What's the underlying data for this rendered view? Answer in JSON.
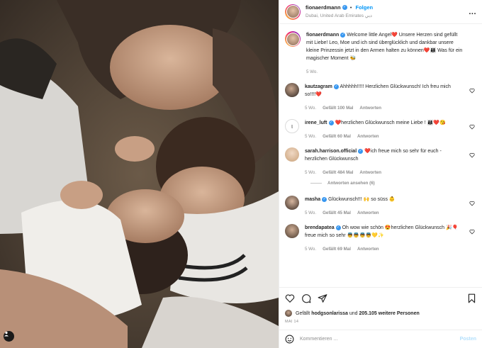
{
  "header": {
    "username": "fionaerdmann",
    "follow_label": "Folgen",
    "location": "Dubai, United Arab Emirates دبي",
    "separator": "•",
    "more_label": "..."
  },
  "caption": {
    "username": "fionaerdmann",
    "text": "Welcome little Angel❤️ Unsere Herzen sind gefüllt mit Liebe! Leo, Moe und ich sind überglücklich und dankbar unsere kleine Prinzessin jetzt in den Armen halten zu können❤️👨‍👩‍👧 Was für ein magischer Moment 🐝",
    "age": "5 Wo."
  },
  "comments": [
    {
      "username": "kautzagram",
      "verified": true,
      "text": "Ahhhhh!!!!! Herzlichen Glückwunsch! Ich freu mich so!!!!❤️",
      "age": "5 Wo.",
      "likes": "Gefällt 100 Mal",
      "reply": "Antworten"
    },
    {
      "username": "irene_luft",
      "verified": true,
      "text": "❤️herzlichen Glückwunsch meine Liebe ! 👨‍👩‍👧❤️😘",
      "age": "5 Wo.",
      "likes": "Gefällt 60 Mal",
      "reply": "Antworten"
    },
    {
      "username": "sarah.harrison.official",
      "verified": true,
      "text": "❤️ich freue mich so sehr für euch - herzlichen Glückwunsch",
      "age": "5 Wo.",
      "likes": "Gefällt 484 Mal",
      "reply": "Antworten",
      "replies_label": "Antworten ansehen (6)"
    },
    {
      "username": "masha",
      "verified": true,
      "text": "Glückwunsch!!! 🙌 so süss 👶",
      "age": "5 Wo.",
      "likes": "Gefällt 45 Mal",
      "reply": "Antworten"
    },
    {
      "username": "brendapatea",
      "verified": true,
      "text": "Oh wow wie schön 😍herzlichen Glückwunsch 🎉🎈 freue mich so sehr 👼👼👼👼💛✨",
      "age": "5 Wo.",
      "likes": "Gefällt 69 Mal",
      "reply": "Antworten"
    }
  ],
  "likes_line": {
    "prefix": "Gefällt",
    "user": "hodgsonlarissa",
    "middle": "und",
    "count": "205.105 weitere Personen"
  },
  "post_date": "MAI 14",
  "add_comment": {
    "placeholder": "Kommentieren ...",
    "post_label": "Posten"
  },
  "colors": {
    "accent": "#0095f6",
    "verified": "#3897f0",
    "muted": "#8e8e8e"
  },
  "icons": [
    "heart-icon",
    "comment-icon",
    "share-icon",
    "bookmark-icon",
    "emoji-icon",
    "tag-user-icon",
    "more-icon"
  ]
}
